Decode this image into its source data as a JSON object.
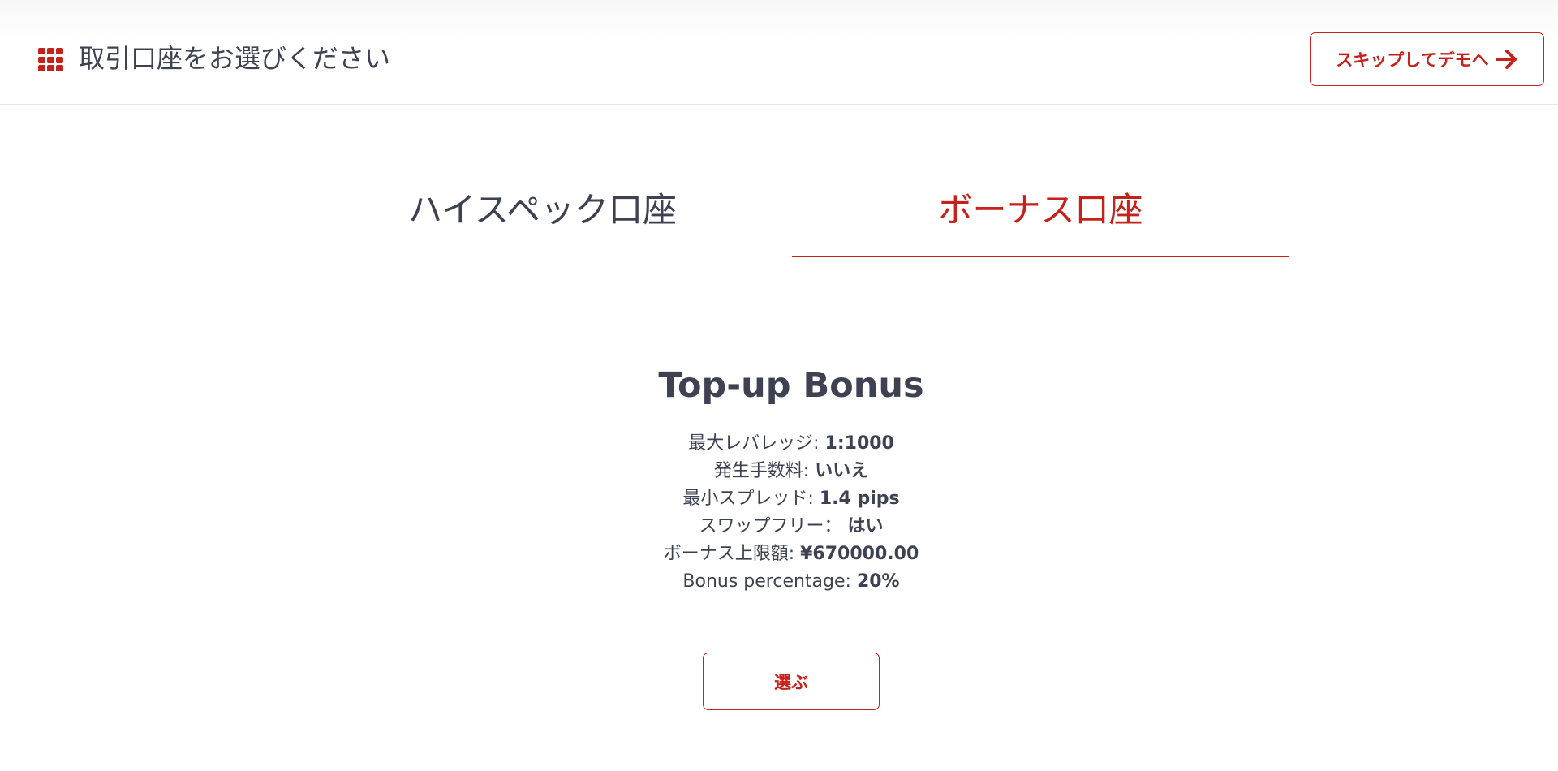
{
  "header": {
    "title": "取引口座をお選びください",
    "menu_icon": "grid-menu-icon",
    "skip_button_label": "スキップしてデモへ",
    "skip_icon": "arrow-right-icon"
  },
  "tabs": [
    {
      "label": "ハイスペック口座",
      "active": false
    },
    {
      "label": "ボーナス口座",
      "active": true
    }
  ],
  "card": {
    "title": "Top-up Bonus",
    "features": [
      {
        "label": "最大レバレッジ: ",
        "value": "1:1000"
      },
      {
        "label": "発生手数料: ",
        "value": "いいえ"
      },
      {
        "label": "最小スプレッド: ",
        "value": "1.4 pips"
      },
      {
        "label": "スワップフリー： ",
        "value": "はい"
      },
      {
        "label": "ボーナス上限額: ",
        "value": "¥670000.00"
      },
      {
        "label": "Bonus percentage: ",
        "value": "20%"
      }
    ],
    "select_button_label": "選ぶ"
  },
  "colors": {
    "accent": "#c4221b",
    "text": "#3d4152",
    "divider": "#e2e2e2"
  }
}
